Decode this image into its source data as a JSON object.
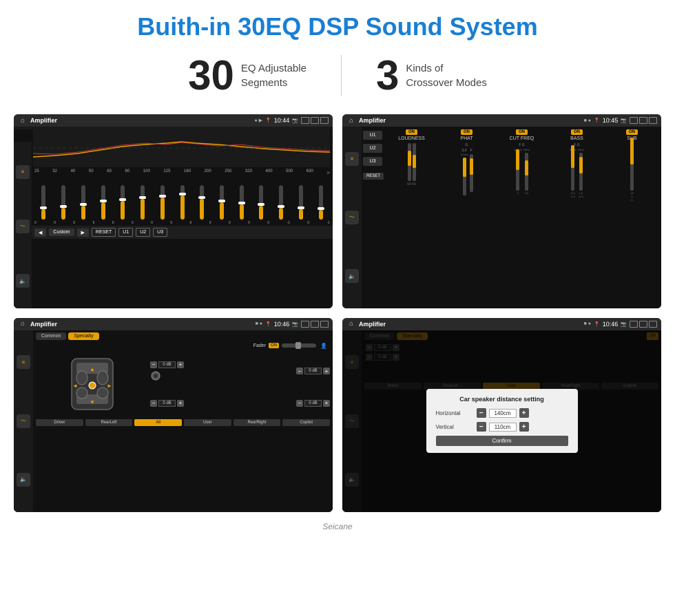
{
  "page": {
    "title": "Buith-in 30EQ DSP Sound System"
  },
  "stats": {
    "eq_number": "30",
    "eq_text_line1": "EQ Adjustable",
    "eq_text_line2": "Segments",
    "crossover_number": "3",
    "crossover_text_line1": "Kinds of",
    "crossover_text_line2": "Crossover Modes"
  },
  "screen1": {
    "app": "Amplifier",
    "time": "10:44",
    "freq_labels": [
      "25",
      "32",
      "40",
      "50",
      "63",
      "80",
      "100",
      "125",
      "160",
      "200",
      "250",
      "320",
      "400",
      "500",
      "630"
    ],
    "bottom_btns": [
      "Custom",
      "RESET",
      "U1",
      "U2",
      "U3"
    ]
  },
  "screen2": {
    "app": "Amplifier",
    "time": "10:45",
    "u_buttons": [
      "U1",
      "U2",
      "U3"
    ],
    "cols": [
      {
        "on": true,
        "label": "LOUDNESS"
      },
      {
        "on": true,
        "label": "PHAT"
      },
      {
        "on": true,
        "label": "CUT FREQ"
      },
      {
        "on": true,
        "label": "BASS"
      },
      {
        "on": true,
        "label": "SUB"
      }
    ],
    "reset_label": "RESET"
  },
  "screen3": {
    "app": "Amplifier",
    "time": "10:46",
    "tabs": [
      "Common",
      "Specialty"
    ],
    "active_tab": "Specialty",
    "fader_label": "Fader",
    "fader_on": "ON",
    "db_values": [
      "0 dB",
      "0 dB",
      "0 dB",
      "0 dB"
    ],
    "bottom_btns": [
      "Driver",
      "RearLeft",
      "All",
      "User",
      "RearRight",
      "Copilot"
    ]
  },
  "screen4": {
    "app": "Amplifier",
    "time": "10:46",
    "tabs": [
      "Common",
      "Specialty"
    ],
    "active_tab": "Specialty",
    "dialog": {
      "title": "Car speaker distance setting",
      "horizontal_label": "Horizontal",
      "horizontal_value": "140cm",
      "vertical_label": "Vertical",
      "vertical_value": "110cm",
      "confirm_label": "Confirm"
    },
    "db_values": [
      "0 dB",
      "0 dB"
    ],
    "bottom_btns": [
      "Driver",
      "RearLeft..",
      "User",
      "RearRight",
      "Copilot"
    ]
  },
  "watermark": "Seicane"
}
